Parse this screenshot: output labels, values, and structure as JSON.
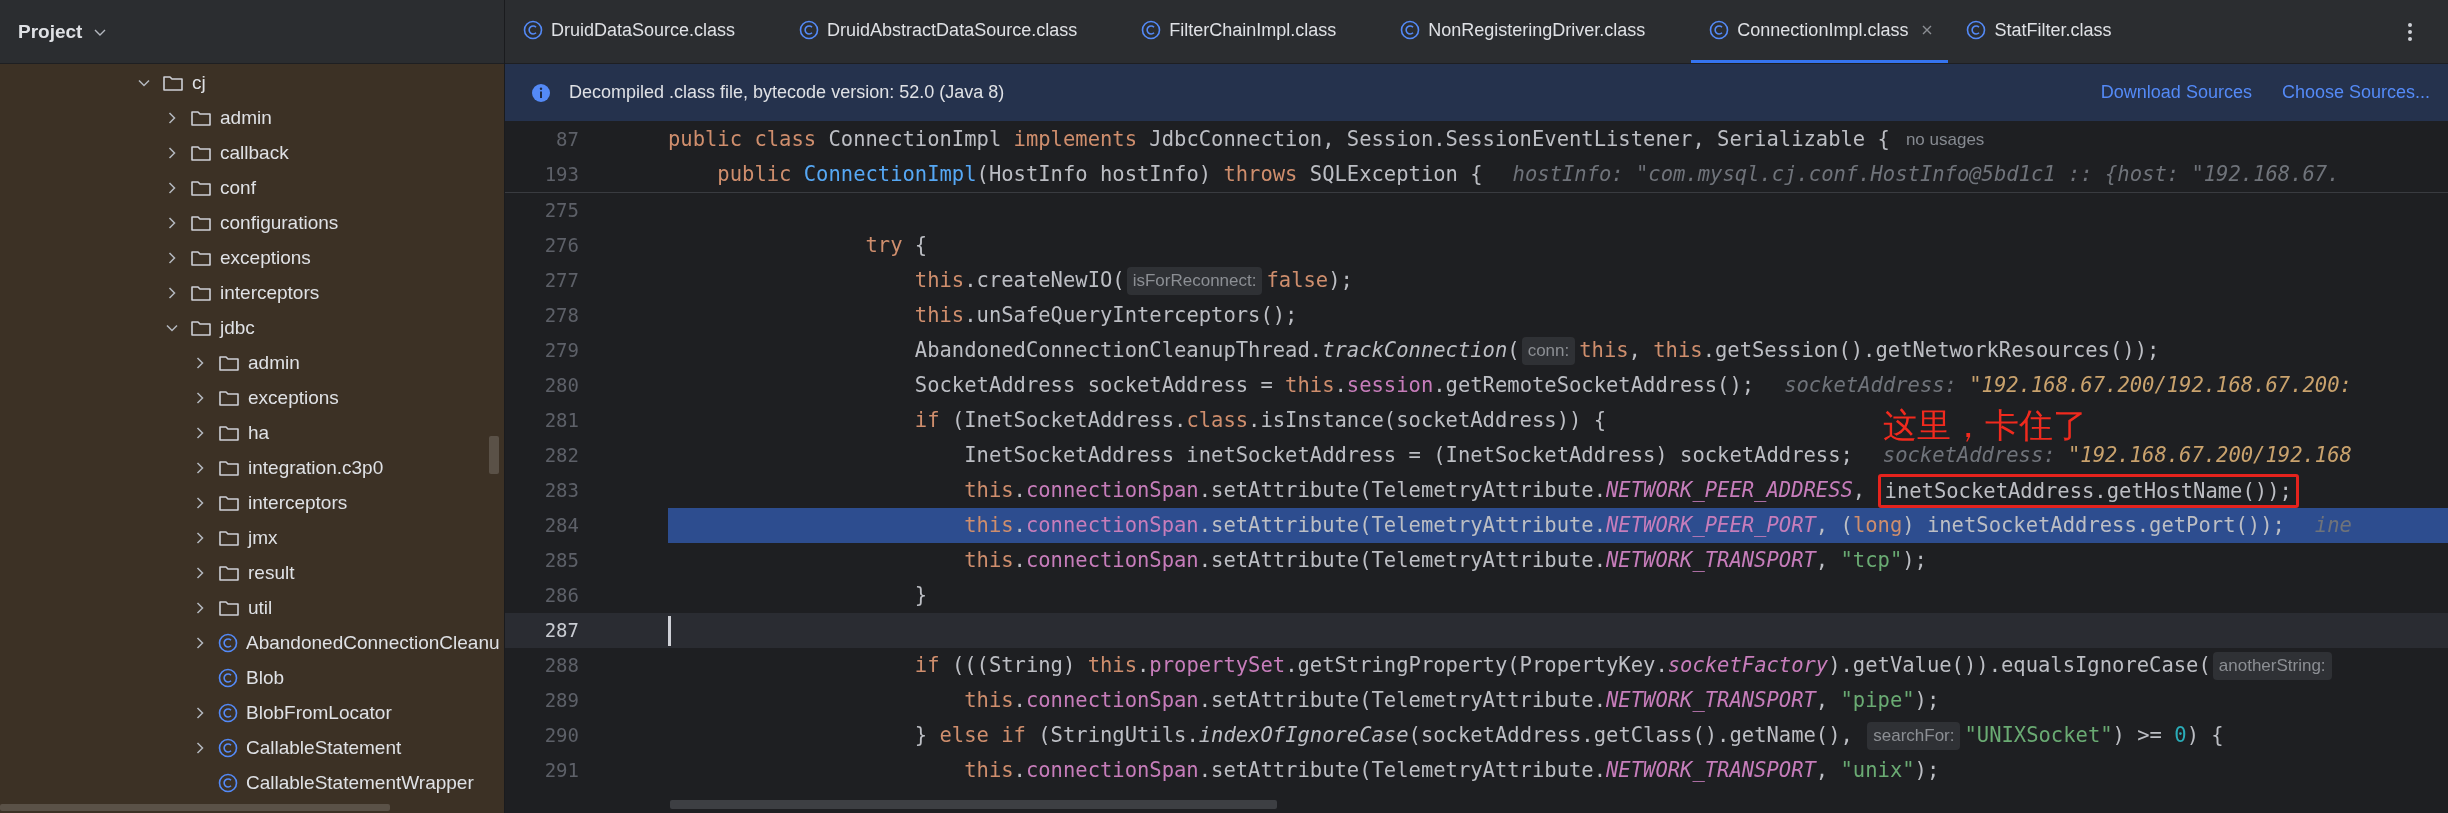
{
  "project_panel": {
    "title": "Project",
    "tree": [
      {
        "name": "cj",
        "kind": "folder",
        "expandable": true,
        "expanded": true,
        "children": [
          {
            "name": "admin",
            "kind": "folder",
            "expandable": true,
            "expanded": false
          },
          {
            "name": "callback",
            "kind": "folder",
            "expandable": true,
            "expanded": false
          },
          {
            "name": "conf",
            "kind": "folder",
            "expandable": true,
            "expanded": false
          },
          {
            "name": "configurations",
            "kind": "folder",
            "expandable": true,
            "expanded": false
          },
          {
            "name": "exceptions",
            "kind": "folder",
            "expandable": true,
            "expanded": false
          },
          {
            "name": "interceptors",
            "kind": "folder",
            "expandable": true,
            "expanded": false
          },
          {
            "name": "jdbc",
            "kind": "folder",
            "expandable": true,
            "expanded": true,
            "children": [
              {
                "name": "admin",
                "kind": "folder",
                "expandable": true,
                "expanded": false
              },
              {
                "name": "exceptions",
                "kind": "folder",
                "expandable": true,
                "expanded": false
              },
              {
                "name": "ha",
                "kind": "folder",
                "expandable": true,
                "expanded": false
              },
              {
                "name": "integration.c3p0",
                "kind": "folder",
                "expandable": true,
                "expanded": false
              },
              {
                "name": "interceptors",
                "kind": "folder",
                "expandable": true,
                "expanded": false
              },
              {
                "name": "jmx",
                "kind": "folder",
                "expandable": true,
                "expanded": false
              },
              {
                "name": "result",
                "kind": "folder",
                "expandable": true,
                "expanded": false
              },
              {
                "name": "util",
                "kind": "folder",
                "expandable": true,
                "expanded": false
              },
              {
                "name": "AbandonedConnectionCleanu",
                "kind": "class",
                "expandable": true,
                "expanded": false
              },
              {
                "name": "Blob",
                "kind": "class",
                "expandable": false,
                "expanded": false
              },
              {
                "name": "BlobFromLocator",
                "kind": "class",
                "expandable": true,
                "expanded": false
              },
              {
                "name": "CallableStatement",
                "kind": "class",
                "expandable": true,
                "expanded": false
              },
              {
                "name": "CallableStatementWrapper",
                "kind": "class",
                "expandable": false,
                "expanded": false
              }
            ]
          }
        ]
      }
    ]
  },
  "tabs": [
    {
      "label": "DruidDataSource.class",
      "selected": false
    },
    {
      "label": "DruidAbstractDataSource.class",
      "selected": false
    },
    {
      "label": "FilterChainImpl.class",
      "selected": false
    },
    {
      "label": "NonRegisteringDriver.class",
      "selected": false
    },
    {
      "label": "ConnectionImpl.class",
      "selected": true
    },
    {
      "label": "StatFilter.class",
      "selected": false
    }
  ],
  "notification": {
    "text": "Decompiled .class file, bytecode version: 52.0 (Java 8)",
    "links": [
      "Download Sources",
      "Choose Sources..."
    ]
  },
  "editor": {
    "sticky_lines": [
      {
        "number": "87",
        "tokens": [
          {
            "kind": "kw",
            "text": "public class "
          },
          {
            "kind": "plain",
            "text": "ConnectionImpl "
          },
          {
            "kind": "kw",
            "text": "implements "
          },
          {
            "kind": "plain",
            "text": "JdbcConnection, Session.SessionEventListener, Serializable {"
          },
          {
            "kind": "hint",
            "text": "no usages"
          }
        ]
      },
      {
        "number": "193",
        "tokens": [
          {
            "kind": "kw",
            "text": "    public "
          },
          {
            "kind": "decl",
            "text": "ConnectionImpl"
          },
          {
            "kind": "plain",
            "text": "(HostInfo hostInfo) "
          },
          {
            "kind": "kw",
            "text": "throws "
          },
          {
            "kind": "plain",
            "text": "SQLException {"
          },
          {
            "kind": "dbg",
            "text": "hostInfo: \"com.mysql.cj.conf.HostInfo@5bd1c1 :: {host: \"192.168.67."
          }
        ]
      }
    ],
    "lines": [
      {
        "number": "275",
        "execution_point": false,
        "caret": false
      },
      {
        "number": "276",
        "execution_point": false,
        "caret": false,
        "tokens": [
          {
            "kind": "kw",
            "text": "                try "
          },
          {
            "kind": "plain",
            "text": "{"
          }
        ]
      },
      {
        "number": "277",
        "execution_point": false,
        "caret": false,
        "tokens": [
          {
            "kind": "kw",
            "text": "                    this"
          },
          {
            "kind": "plain",
            "text": ".createNewIO("
          },
          {
            "kind": "inlay",
            "text": "isForReconnect:"
          },
          {
            "kind": "kw",
            "text": "false"
          },
          {
            "kind": "plain",
            "text": ");"
          }
        ]
      },
      {
        "number": "278",
        "execution_point": false,
        "caret": false,
        "tokens": [
          {
            "kind": "kw",
            "text": "                    this"
          },
          {
            "kind": "plain",
            "text": ".unSafeQueryInterceptors();"
          }
        ]
      },
      {
        "number": "279",
        "execution_point": false,
        "caret": false,
        "tokens": [
          {
            "kind": "plain",
            "text": "                    AbandonedConnectionCleanupThread."
          },
          {
            "kind": "static",
            "text": "trackConnection"
          },
          {
            "kind": "plain",
            "text": "("
          },
          {
            "kind": "inlay",
            "text": "conn:"
          },
          {
            "kind": "kw",
            "text": "this"
          },
          {
            "kind": "plain",
            "text": ", "
          },
          {
            "kind": "kw",
            "text": "this"
          },
          {
            "kind": "plain",
            "text": ".getSession().getNetworkResources());"
          }
        ]
      },
      {
        "number": "280",
        "execution_point": false,
        "caret": false,
        "tokens": [
          {
            "kind": "plain",
            "text": "                    SocketAddress socketAddress = "
          },
          {
            "kind": "kw",
            "text": "this"
          },
          {
            "kind": "plain",
            "text": "."
          },
          {
            "kind": "field",
            "text": "session"
          },
          {
            "kind": "plain",
            "text": ".getRemoteSocketAddress();"
          },
          {
            "kind": "dbg",
            "text": "socketAddress: "
          },
          {
            "kind": "dbgval",
            "text": "\"192.168.67.200/192.168.67.200:"
          }
        ]
      },
      {
        "number": "281",
        "execution_point": false,
        "caret": false,
        "tokens": [
          {
            "kind": "kw",
            "text": "                    if "
          },
          {
            "kind": "plain",
            "text": "(InetSocketAddress."
          },
          {
            "kind": "kw",
            "text": "class"
          },
          {
            "kind": "plain",
            "text": ".isInstance(socketAddress)) {"
          }
        ]
      },
      {
        "number": "282",
        "execution_point": false,
        "caret": false,
        "tokens": [
          {
            "kind": "plain",
            "text": "                        InetSocketAddress inetSocketAddress = (InetSocketAddress) socketAddress;"
          },
          {
            "kind": "dbg",
            "text": "socketAddress: "
          },
          {
            "kind": "dbgval",
            "text": "\"192.168.67.200/192.168"
          }
        ]
      },
      {
        "number": "283",
        "execution_point": false,
        "caret": false,
        "tokens": [
          {
            "kind": "kw",
            "text": "                        this"
          },
          {
            "kind": "plain",
            "text": "."
          },
          {
            "kind": "field",
            "text": "connectionSpan"
          },
          {
            "kind": "plain",
            "text": ".setAttribute(TelemetryAttribute."
          },
          {
            "kind": "const",
            "text": "NETWORK_PEER_ADDRESS"
          },
          {
            "kind": "plain",
            "text": ", "
          },
          {
            "kind": "boxed",
            "text": "inetSocketAddress.getHostName());"
          }
        ]
      },
      {
        "number": "284",
        "execution_point": true,
        "caret": false,
        "tokens": [
          {
            "kind": "kw",
            "text": "                        this"
          },
          {
            "kind": "plain",
            "text": "."
          },
          {
            "kind": "field",
            "text": "connectionSpan"
          },
          {
            "kind": "plain",
            "text": ".setAttribute(TelemetryAttribute."
          },
          {
            "kind": "const",
            "text": "NETWORK_PEER_PORT"
          },
          {
            "kind": "plain",
            "text": ", ("
          },
          {
            "kind": "kw",
            "text": "long"
          },
          {
            "kind": "plain",
            "text": ") inetSocketAddress.getPort());"
          },
          {
            "kind": "dbg",
            "text": "ine"
          }
        ]
      },
      {
        "number": "285",
        "execution_point": false,
        "caret": false,
        "tokens": [
          {
            "kind": "kw",
            "text": "                        this"
          },
          {
            "kind": "plain",
            "text": "."
          },
          {
            "kind": "field",
            "text": "connectionSpan"
          },
          {
            "kind": "plain",
            "text": ".setAttribute(TelemetryAttribute."
          },
          {
            "kind": "const",
            "text": "NETWORK_TRANSPORT"
          },
          {
            "kind": "plain",
            "text": ", "
          },
          {
            "kind": "str",
            "text": "\"tcp\""
          },
          {
            "kind": "plain",
            "text": ");"
          }
        ]
      },
      {
        "number": "286",
        "execution_point": false,
        "caret": false,
        "tokens": [
          {
            "kind": "plain",
            "text": "                    }"
          }
        ]
      },
      {
        "number": "287",
        "execution_point": false,
        "caret": true
      },
      {
        "number": "288",
        "execution_point": false,
        "caret": false,
        "tokens": [
          {
            "kind": "kw",
            "text": "                    if "
          },
          {
            "kind": "plain",
            "text": "(((String) "
          },
          {
            "kind": "kw",
            "text": "this"
          },
          {
            "kind": "plain",
            "text": "."
          },
          {
            "kind": "field",
            "text": "propertySet"
          },
          {
            "kind": "plain",
            "text": ".getStringProperty(PropertyKey."
          },
          {
            "kind": "const",
            "text": "socketFactory"
          },
          {
            "kind": "plain",
            "text": ").getValue()).equalsIgnoreCase("
          },
          {
            "kind": "inlay",
            "text": "anotherString:"
          }
        ]
      },
      {
        "number": "289",
        "execution_point": false,
        "caret": false,
        "tokens": [
          {
            "kind": "kw",
            "text": "                        this"
          },
          {
            "kind": "plain",
            "text": "."
          },
          {
            "kind": "field",
            "text": "connectionSpan"
          },
          {
            "kind": "plain",
            "text": ".setAttribute(TelemetryAttribute."
          },
          {
            "kind": "const",
            "text": "NETWORK_TRANSPORT"
          },
          {
            "kind": "plain",
            "text": ", "
          },
          {
            "kind": "str",
            "text": "\"pipe\""
          },
          {
            "kind": "plain",
            "text": ");"
          }
        ]
      },
      {
        "number": "290",
        "execution_point": false,
        "caret": false,
        "tokens": [
          {
            "kind": "plain",
            "text": "                    } "
          },
          {
            "kind": "kw",
            "text": "else if "
          },
          {
            "kind": "plain",
            "text": "(StringUtils."
          },
          {
            "kind": "static",
            "text": "indexOfIgnoreCase"
          },
          {
            "kind": "plain",
            "text": "(socketAddress.getClass().getName(), "
          },
          {
            "kind": "inlay",
            "text": "searchFor:"
          },
          {
            "kind": "str",
            "text": "\"UNIXSocket\""
          },
          {
            "kind": "plain",
            "text": ") >= "
          },
          {
            "kind": "num",
            "text": "0"
          },
          {
            "kind": "plain",
            "text": ") {"
          }
        ]
      },
      {
        "number": "291",
        "execution_point": false,
        "caret": false,
        "tokens": [
          {
            "kind": "kw",
            "text": "                        this"
          },
          {
            "kind": "plain",
            "text": "."
          },
          {
            "kind": "field",
            "text": "connectionSpan"
          },
          {
            "kind": "plain",
            "text": ".setAttribute(TelemetryAttribute."
          },
          {
            "kind": "const",
            "text": "NETWORK_TRANSPORT"
          },
          {
            "kind": "plain",
            "text": ", "
          },
          {
            "kind": "str",
            "text": "\"unix\""
          },
          {
            "kind": "plain",
            "text": ");"
          }
        ]
      }
    ],
    "annotation": {
      "text": "这里，卡住了"
    }
  }
}
